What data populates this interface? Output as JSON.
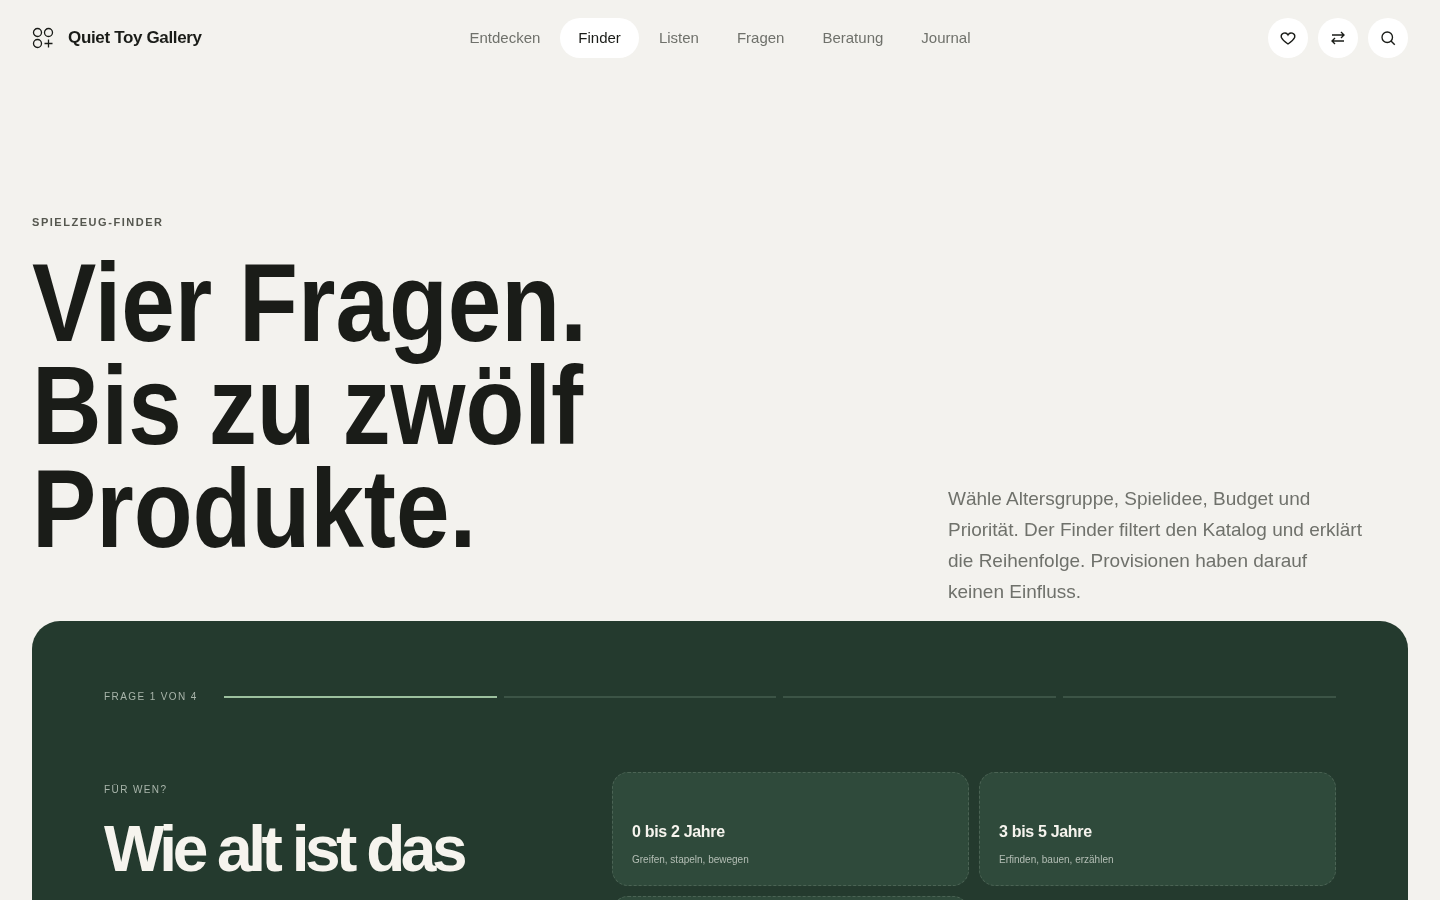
{
  "brand": {
    "name": "Quiet Toy Gallery"
  },
  "nav": [
    {
      "label": "Entdecken",
      "selected": false
    },
    {
      "label": "Finder",
      "selected": true
    },
    {
      "label": "Listen",
      "selected": false
    },
    {
      "label": "Fragen",
      "selected": false
    },
    {
      "label": "Beratung",
      "selected": false
    },
    {
      "label": "Journal",
      "selected": false
    }
  ],
  "hero": {
    "eyebrow": "SPIELZEUG-FINDER",
    "headline_lines": [
      "Vier Fragen.",
      "Bis zu zwölf",
      "Produkte."
    ],
    "intro": "Wähle Altersgruppe, Spielidee, Budget und Priorität. Der Finder filtert den Katalog und erklärt die Reihenfolge. Provisionen haben darauf keinen Einfluss."
  },
  "finder": {
    "step_label": "FRAGE 1 VON 4",
    "progress": [
      {
        "level": 1
      },
      {
        "level": 0
      },
      {
        "level": 0
      },
      {
        "level": 0
      }
    ],
    "eyebrow": "FÜR WEN?",
    "question": "Wie alt ist das",
    "options": [
      {
        "title": "0 bis 2 Jahre",
        "subtitle": "Greifen, stapeln, bewegen"
      },
      {
        "title": "3 bis 5 Jahre",
        "subtitle": "Erfinden, bauen, erzählen"
      }
    ]
  }
}
